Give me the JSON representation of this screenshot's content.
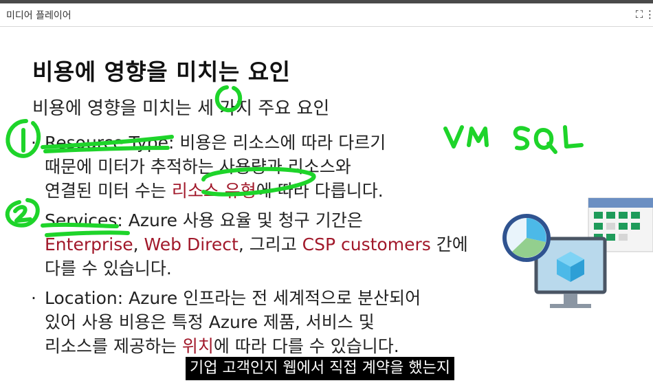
{
  "window": {
    "title": "미디어 플레이어"
  },
  "slide": {
    "heading": "비용에 영향을 미치는 요인",
    "subheading": "비용에 영향을 미치는 세 가지 주요 요인",
    "bullets": [
      {
        "term": "Resource Type:",
        "line1": " 비용은 리소스에 따라 다르기",
        "line2": "때문에 미터가 추적하는 사용량과 리소스와",
        "line3a": "연결된 미터 수는 ",
        "line3red": "리소스 유형",
        "line3b": "에 따라 다릅니다."
      },
      {
        "term": "Services:",
        "line1": " Azure 사용 요율 및 청구 기간은",
        "line2red1": "Enterprise",
        "line2sep1": ", ",
        "line2red2": "Web Direct",
        "line2sep2": ", 그리고 ",
        "line2red3": "CSP customers",
        "line2b": " 간에",
        "line3": "다를 수 있습니다."
      },
      {
        "term": "Location:",
        "line1": " Azure 인프라는 전 세계적으로 분산되어",
        "line2": "있어 사용 비용은 특정 Azure 제품, 서비스 및",
        "line3a": "리소스를 제공하는 ",
        "line3red": "위치",
        "line3b": "에 따라 다를 수 있습니다."
      }
    ],
    "annotation": "VM SQL"
  },
  "caption": "기업 고객인지 웹에서 직접 계약을 했는지",
  "colors": {
    "ink": "#1ed42a",
    "accent_red": "#a1182a",
    "calendar_green": "#1e9b5a",
    "calendar_header": "#6b8fc2"
  },
  "icons": [
    "expand-icon",
    "more-icon",
    "calendar-icon",
    "clock-chart-icon",
    "monitor-icon",
    "cube-icon"
  ]
}
